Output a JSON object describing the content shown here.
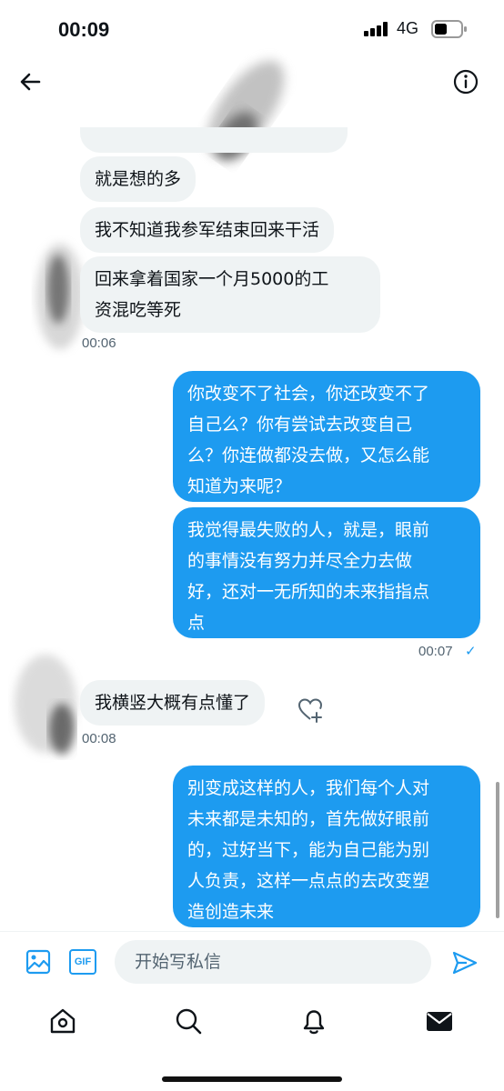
{
  "status_bar": {
    "time": "00:09",
    "network": "4G"
  },
  "header": {
    "back_icon": "arrow-left-icon",
    "info_icon": "info-icon"
  },
  "messages": [
    {
      "dir": "in",
      "text": "就是想的多"
    },
    {
      "dir": "in",
      "text": "我不知道我参军结束回来干活"
    },
    {
      "dir": "in",
      "text": "回来拿着国家一个月5000的工\n资混吃等死"
    },
    {
      "dir": "out",
      "text": "你改变不了社会，你还改变不了\n自己么？你有尝试去改变自己\n么？你连做都没去做，又怎么能\n知道为来呢？"
    },
    {
      "dir": "out",
      "text": "我觉得最失败的人，就是，眼前\n的事情没有努力并尽全力去做\n好，还对一无所知的未来指指点\n点"
    },
    {
      "dir": "in",
      "text": "我横竖大概有点懂了"
    },
    {
      "dir": "out",
      "text": "别变成这样的人，我们每个人对\n未来都是未知的，首先做好眼前\n的，过好当下，能为自己能为别\n人负责，这样一点点的去改变塑\n造创造未来"
    }
  ],
  "timestamps": {
    "t1": "00:06",
    "t2": "00:07",
    "t2_check": "✓",
    "t3": "00:08"
  },
  "composer": {
    "image_icon": "image-icon",
    "gif_label": "GIF",
    "placeholder": "开始写私信",
    "send_icon": "send-icon"
  },
  "tabs": [
    "home-icon",
    "search-icon",
    "notifications-icon",
    "messages-icon"
  ],
  "colors": {
    "accent": "#1d9bf0",
    "bubble_in": "#eff3f4",
    "secondary_text": "#536471"
  }
}
